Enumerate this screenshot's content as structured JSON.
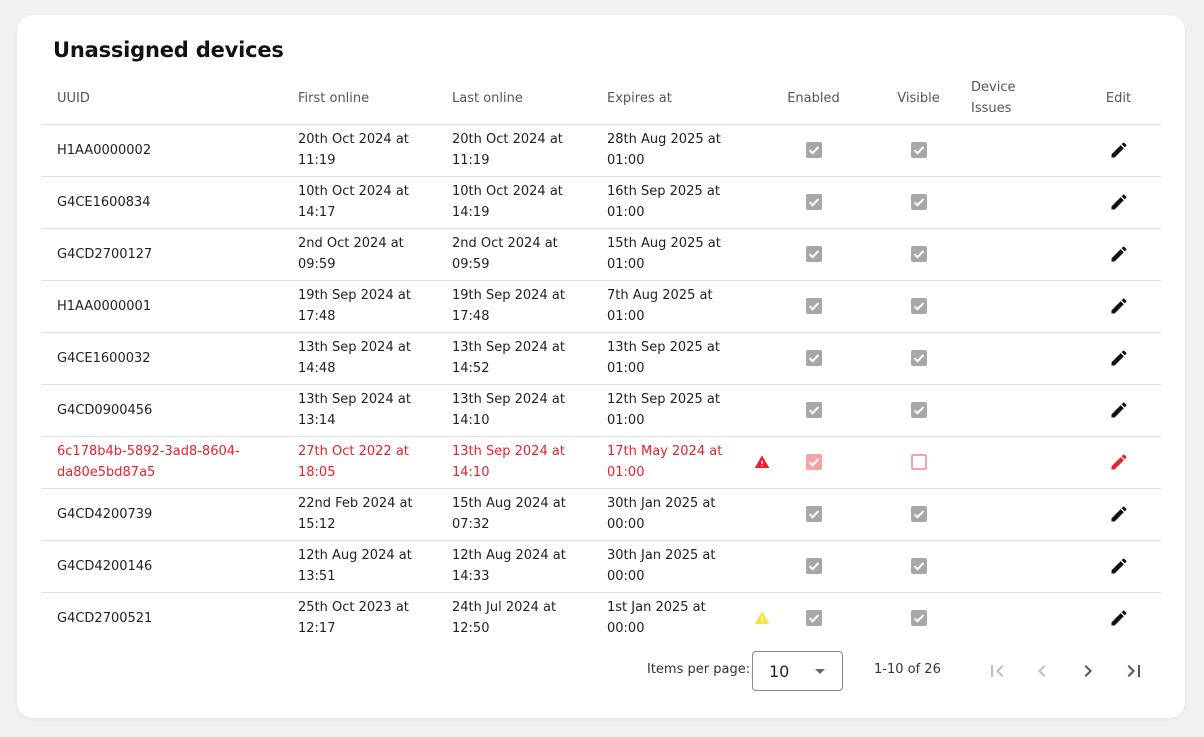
{
  "title": "Unassigned devices",
  "columns": {
    "uuid": "UUID",
    "first_online": "First online",
    "last_online": "Last online",
    "expires_at": "Expires at",
    "enabled": "Enabled",
    "visible": "Visible",
    "device_issues_1": "Device",
    "device_issues_2": "Issues",
    "edit": "Edit"
  },
  "rows": [
    {
      "uuid": [
        "H1AA0000002",
        ""
      ],
      "first": [
        "20th Oct 2024 at",
        "11:19"
      ],
      "last": [
        "20th Oct 2024 at",
        "11:19"
      ],
      "exp": [
        "28th Aug 2025 at",
        "01:00"
      ],
      "enabled": true,
      "visible": true,
      "status": "normal",
      "warning": "none"
    },
    {
      "uuid": [
        "G4CE1600834",
        ""
      ],
      "first": [
        "10th Oct 2024 at",
        "14:17"
      ],
      "last": [
        "10th Oct 2024 at",
        "14:19"
      ],
      "exp": [
        "16th Sep 2025 at",
        "01:00"
      ],
      "enabled": true,
      "visible": true,
      "status": "normal",
      "warning": "none"
    },
    {
      "uuid": [
        "G4CD2700127",
        ""
      ],
      "first": [
        "2nd Oct 2024 at",
        "09:59"
      ],
      "last": [
        "2nd Oct 2024 at",
        "09:59"
      ],
      "exp": [
        "15th Aug 2025 at",
        "01:00"
      ],
      "enabled": true,
      "visible": true,
      "status": "normal",
      "warning": "none"
    },
    {
      "uuid": [
        "H1AA0000001",
        ""
      ],
      "first": [
        "19th Sep 2024 at",
        "17:48"
      ],
      "last": [
        "19th Sep 2024 at",
        "17:48"
      ],
      "exp": [
        "7th Aug 2025 at",
        "01:00"
      ],
      "enabled": true,
      "visible": true,
      "status": "normal",
      "warning": "none"
    },
    {
      "uuid": [
        "G4CE1600032",
        ""
      ],
      "first": [
        "13th Sep 2024 at",
        "14:48"
      ],
      "last": [
        "13th Sep 2024 at",
        "14:52"
      ],
      "exp": [
        "13th Sep 2025 at",
        "01:00"
      ],
      "enabled": true,
      "visible": true,
      "status": "normal",
      "warning": "none"
    },
    {
      "uuid": [
        "G4CD0900456",
        ""
      ],
      "first": [
        "13th Sep 2024 at",
        "13:14"
      ],
      "last": [
        "13th Sep 2024 at",
        "14:10"
      ],
      "exp": [
        "12th Sep 2025 at",
        "01:00"
      ],
      "enabled": true,
      "visible": true,
      "status": "normal",
      "warning": "none"
    },
    {
      "uuid": [
        "6c178b4b-5892-3ad8-8604-",
        "da80e5bd87a5"
      ],
      "first": [
        "27th Oct 2022 at",
        "18:05"
      ],
      "last": [
        "13th Sep 2024 at",
        "14:10"
      ],
      "exp": [
        "17th May 2024 at",
        "01:00"
      ],
      "enabled": true,
      "visible": false,
      "status": "error",
      "warning": "red"
    },
    {
      "uuid": [
        "G4CD4200739",
        ""
      ],
      "first": [
        "22nd Feb 2024 at",
        "15:12"
      ],
      "last": [
        "15th Aug 2024 at",
        "07:32"
      ],
      "exp": [
        "30th Jan 2025 at",
        "00:00"
      ],
      "enabled": true,
      "visible": true,
      "status": "normal",
      "warning": "none"
    },
    {
      "uuid": [
        "G4CD4200146",
        ""
      ],
      "first": [
        "12th Aug 2024 at",
        "13:51"
      ],
      "last": [
        "12th Aug 2024 at",
        "14:33"
      ],
      "exp": [
        "30th Jan 2025 at",
        "00:00"
      ],
      "enabled": true,
      "visible": true,
      "status": "normal",
      "warning": "none"
    },
    {
      "uuid": [
        "G4CD2700521",
        ""
      ],
      "first": [
        "25th Oct 2023 at",
        "12:17"
      ],
      "last": [
        "24th Jul 2024 at",
        "12:50"
      ],
      "exp": [
        "1st Jan 2025 at",
        "00:00"
      ],
      "enabled": true,
      "visible": true,
      "status": "normal",
      "warning": "yellow"
    }
  ],
  "pagination": {
    "items_per_page_label": "Items per page:",
    "items_per_page_value": "10",
    "range_label": "1-10 of 26"
  },
  "colors": {
    "error": "#e8212d",
    "warning_yellow": "#f7e13b",
    "checkbox_gray": "#a7a7a7",
    "checkbox_error": "#f4a3a8"
  },
  "icons": {
    "edit": "pencil-icon",
    "warning": "warning-triangle-icon",
    "first_page": "first-page-icon",
    "prev_page": "chevron-left-icon",
    "next_page": "chevron-right-icon",
    "last_page": "last-page-icon"
  }
}
